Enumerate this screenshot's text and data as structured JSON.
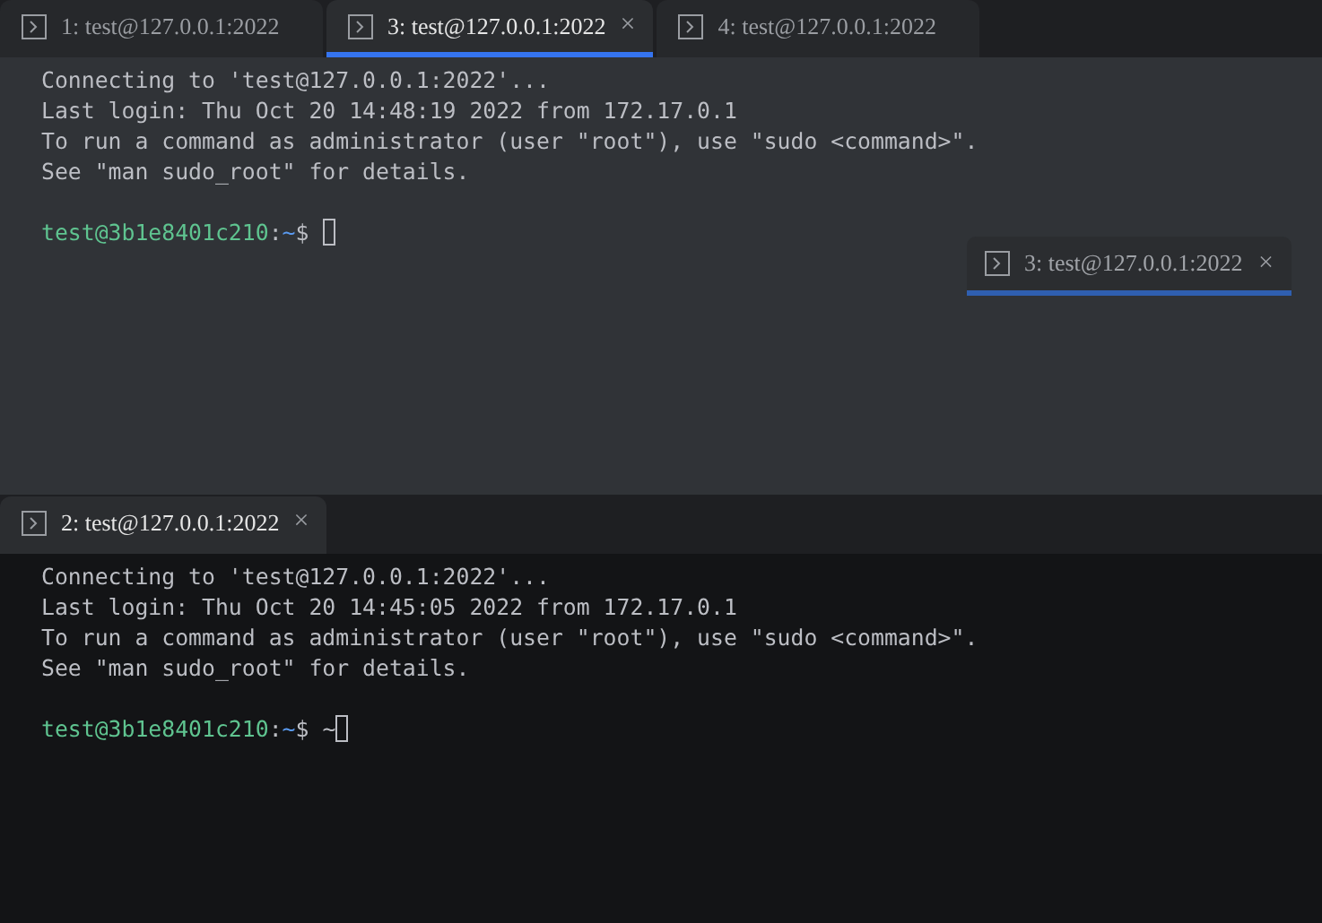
{
  "panes": [
    {
      "focused": true,
      "tabs": [
        {
          "label": "1: test@127.0.0.1:2022",
          "selected": false
        },
        {
          "label": "3: test@127.0.0.1:2022",
          "selected": true,
          "close": "×"
        },
        {
          "label": "4: test@127.0.0.1:2022",
          "selected": false
        }
      ],
      "lines": [
        "Connecting to 'test@127.0.0.1:2022'...",
        "Last login: Thu Oct 20 14:48:19 2022 from 172.17.0.1",
        "To run a command as administrator (user \"root\"), use \"sudo <command>\".",
        "See \"man sudo_root\" for details."
      ],
      "prompt": {
        "user_host": "test@3b1e8401c210",
        "separator": ":",
        "path": "~",
        "symbol": "$"
      }
    },
    {
      "focused": false,
      "tabs": [
        {
          "label": "2: test@127.0.0.1:2022",
          "selected": true,
          "close": "×"
        }
      ],
      "lines": [
        "Connecting to 'test@127.0.0.1:2022'...",
        "Last login: Thu Oct 20 14:45:05 2022 from 172.17.0.1",
        "To run a command as administrator (user \"root\"), use \"sudo <command>\".",
        "See \"man sudo_root\" for details."
      ],
      "prompt": {
        "user_host": "test@3b1e8401c210",
        "separator": ":",
        "path": "~",
        "symbol": "$",
        "input": "~"
      }
    }
  ],
  "dragged_tab": {
    "label": "3: test@127.0.0.1:2022",
    "close": "×"
  }
}
